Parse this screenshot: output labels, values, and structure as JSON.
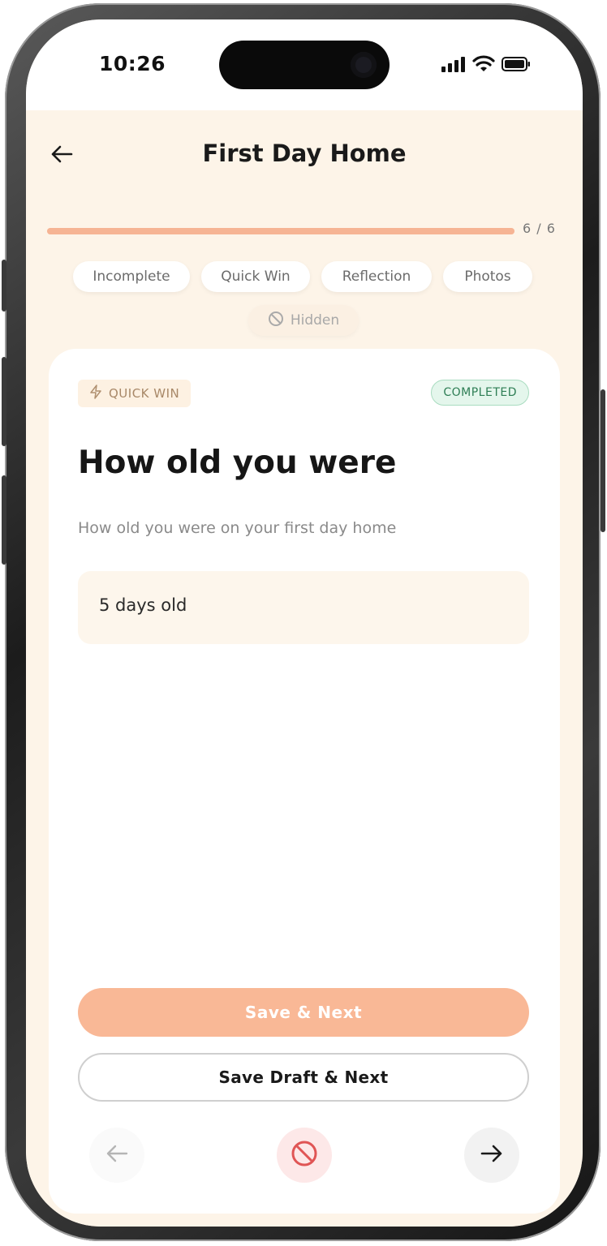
{
  "status_bar": {
    "time": "10:26",
    "icons": [
      "signal-icon",
      "wifi-icon",
      "battery-icon"
    ]
  },
  "header": {
    "title": "First Day Home",
    "back_icon": "arrow-left-icon"
  },
  "progress": {
    "label": "6 / 6",
    "current": 6,
    "total": 6,
    "fraction": 1.0
  },
  "filters": {
    "chips": [
      {
        "label": "Incomplete"
      },
      {
        "label": "Quick Win"
      },
      {
        "label": "Reflection"
      },
      {
        "label": "Photos"
      }
    ],
    "hidden_chip": {
      "label": "Hidden",
      "icon": "ban-icon"
    }
  },
  "card": {
    "type_tag": {
      "label": "QUICK WIN",
      "icon": "bolt-icon"
    },
    "status_tag": {
      "label": "COMPLETED"
    },
    "question": "How old you were",
    "subtitle": "How old you were on your first day home",
    "answer": "5 days old"
  },
  "actions": {
    "save_next": "Save & Next",
    "save_draft_next": "Save Draft & Next"
  },
  "nav": {
    "prev_icon": "arrow-left-icon",
    "hide_icon": "ban-icon",
    "next_icon": "arrow-right-icon"
  },
  "colors": {
    "background": "#fdf4e8",
    "accent": "#f9b896",
    "completed_green": "#2e7e55",
    "hide_red": "#e05555"
  }
}
